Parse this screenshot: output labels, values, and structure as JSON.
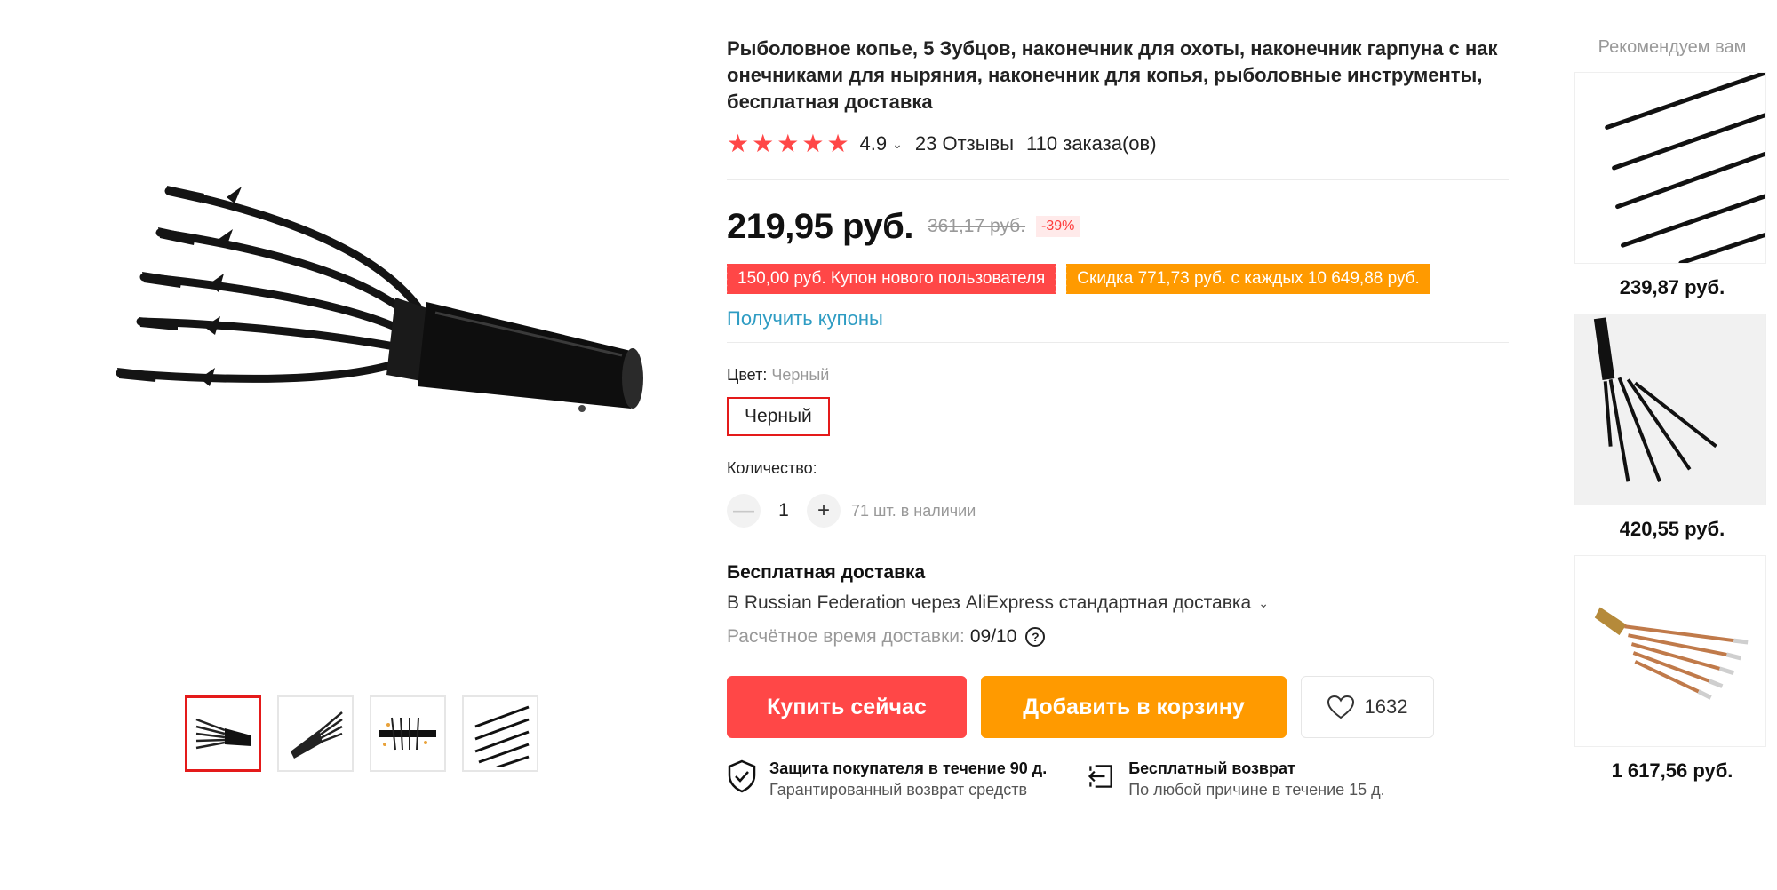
{
  "gallery": {
    "main_image": "black 5-prong fishing spear head",
    "thumbnails": [
      {
        "alt": "fishing spear thumbnail 1",
        "active": true
      },
      {
        "alt": "fishing spear thumbnail 2",
        "active": false
      },
      {
        "alt": "fishing spear thumbnail 3",
        "active": false
      },
      {
        "alt": "fishing spear thumbnail 4",
        "active": false
      }
    ]
  },
  "product": {
    "title": "Рыболовное копье, 5 Зубцов, наконечник для охоты, наконечник гарпуна с наконечниками для ныряния, наконечник для копья, рыболовные инструменты, бесплатная доставка",
    "rating": "4.9",
    "stars": 5,
    "reviews": "23 Отзывы",
    "orders": "110 заказа(ов)",
    "price": "219,95 руб.",
    "old_price": "361,17 руб.",
    "discount": "-39%",
    "promos": {
      "new_user": "150,00 руб. Купон нового пользователя",
      "discount": "Скидка 771,73 руб. с каждых 10 649,88 руб."
    },
    "get_coupons": "Получить купоны",
    "color_label": "Цвет:",
    "color_value": "Черный",
    "color_option": "Черный",
    "quantity_label": "Количество:",
    "quantity": "1",
    "minus": "—",
    "plus": "+",
    "stock": "71 шт. в наличии"
  },
  "shipping": {
    "title": "Бесплатная доставка",
    "method": "В Russian Federation через AliExpress стандартная доставка",
    "eta_label": "Расчётное время доставки:",
    "eta_date": "09/10",
    "help": "?"
  },
  "actions": {
    "buy_now": "Купить сейчас",
    "add_to_cart": "Добавить в корзину",
    "wishlist_count": "1632"
  },
  "guarantees": [
    {
      "title": "Защита покупателя в течение 90 д.",
      "subtitle": "Гарантированный возврат средств",
      "icon": "shield-check-icon"
    },
    {
      "title": "Бесплатный возврат",
      "subtitle": "По любой причине в течение 15 д.",
      "icon": "return-icon"
    }
  ],
  "recommendations": {
    "title": "Рекомендуем вам",
    "items": [
      {
        "price": "239,87 руб."
      },
      {
        "price": "420,55 руб."
      },
      {
        "price": "1 617,56 руб."
      }
    ]
  },
  "colors": {
    "accent_red": "#ff4747",
    "accent_orange": "#ff9a00",
    "link_blue": "#2e9cc3"
  }
}
